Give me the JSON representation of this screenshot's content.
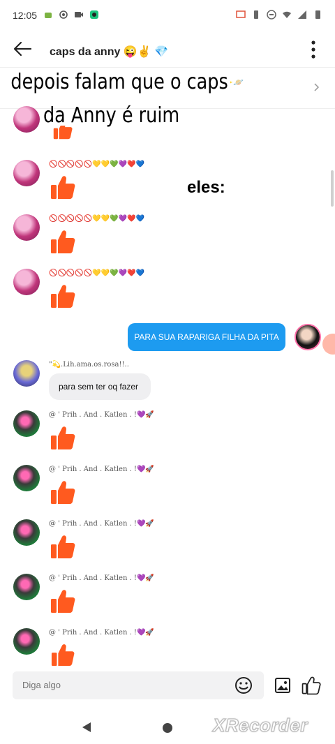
{
  "status": {
    "time": "12:05"
  },
  "chat": {
    "title": "caps da anny 😜✌️ 💎",
    "pinned_preview": "A......!✨🪐"
  },
  "overlay": {
    "line1": "depois falam que o caps",
    "line2": "da Anny é ruim",
    "eles": "eles:"
  },
  "messages": [
    {
      "sender": "🚫🚫🚫🚫🚫💛💛💚💜❤️💙",
      "type": "like"
    },
    {
      "sender": "🚫🚫🚫🚫🚫💛💛💚💜❤️💙",
      "type": "like"
    },
    {
      "sender": "🚫🚫🚫🚫🚫💛💛💚💜❤️💙",
      "type": "like"
    },
    {
      "sent_text": "PARA SUA RAPARIGA FILHA DA PITA"
    },
    {
      "sender": "\"💫.Lih.ama.os.rosa!!..",
      "text": "para sem ter oq fazer"
    },
    {
      "sender": "@ ' Prih . And . Katlen . !💜🚀",
      "type": "like"
    },
    {
      "sender": "@ ' Prih . And . Katlen . !💜🚀",
      "type": "like"
    },
    {
      "sender": "@ ' Prih . And . Katlen . !💜🚀",
      "type": "like"
    },
    {
      "sender": "@ ' Prih . And . Katlen . !💜🚀",
      "type": "like"
    },
    {
      "sender": "@ ' Prih . And . Katlen . !💜🚀",
      "type": "like"
    }
  ],
  "composer": {
    "placeholder": "Diga algo"
  },
  "watermark": "XRecorder",
  "colors": {
    "thumb": "#ff5a1f",
    "sent_bubble": "#1d9bf0"
  }
}
